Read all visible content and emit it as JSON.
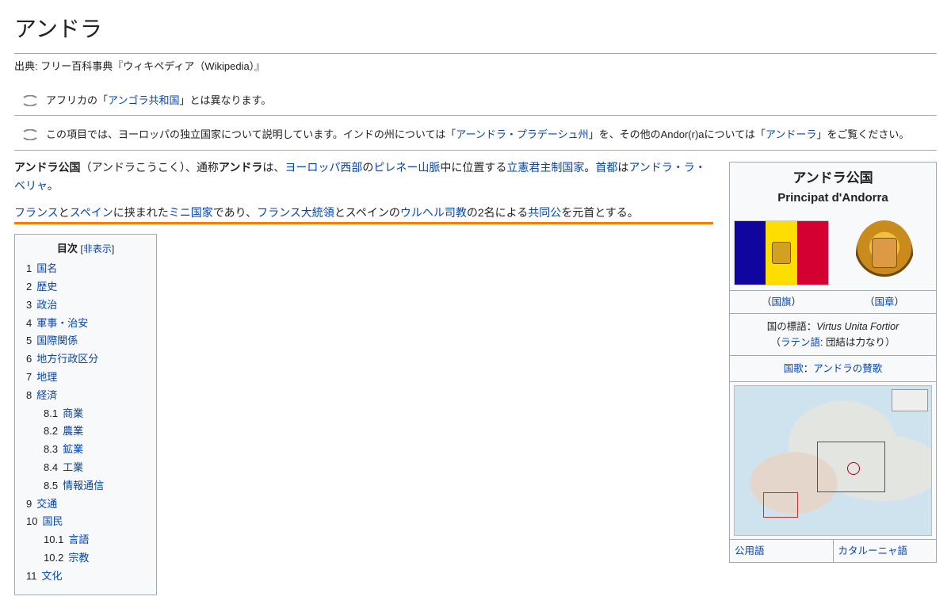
{
  "title": "アンドラ",
  "source_line": "出典: フリー百科事典『ウィキペディア（Wikipedia）』",
  "hatnote1": {
    "pre": "アフリカの「",
    "link": "アンゴラ共和国",
    "post": "」とは異なります。"
  },
  "hatnote2": {
    "t1": "この項目では、ヨーロッパの独立国家について説明しています。インドの州については「",
    "link1": "アーンドラ・プラデーシュ州",
    "t2": "」を、その他のAndor(r)aについては「",
    "link2": "アンドーラ",
    "t3": "」をご覧ください。"
  },
  "lead1": {
    "bold1": "アンドラ公国",
    "t1": "（アンドラこうこく）、通称",
    "bold2": "アンドラ",
    "t2": "は、",
    "link1": "ヨーロッパ西部",
    "t3": "の",
    "link2": "ピレネー山脈",
    "t4": "中に位置する",
    "link3": "立憲君主制国家",
    "t5": "。",
    "link4": "首都",
    "t6": "は",
    "link5": "アンドラ・ラ・ベリャ",
    "t7": "。"
  },
  "lead2": {
    "link1": "フランス",
    "t1": "と",
    "link2": "スペイン",
    "t2": "に挟まれた",
    "link3": "ミニ国家",
    "t3": "であり、",
    "link4": "フランス大統領",
    "t4": "とスペインの",
    "link5": "ウルヘル司教",
    "t5": "の2名による",
    "link6": "共同公",
    "t6": "を元首とする。"
  },
  "toc": {
    "title": "目次",
    "toggle_open": "[",
    "toggle_label": "非表示",
    "toggle_close": "]",
    "items": [
      {
        "num": "1",
        "label": "国名",
        "sub": false
      },
      {
        "num": "2",
        "label": "歴史",
        "sub": false
      },
      {
        "num": "3",
        "label": "政治",
        "sub": false
      },
      {
        "num": "4",
        "label": "軍事・治安",
        "sub": false
      },
      {
        "num": "5",
        "label": "国際関係",
        "sub": false
      },
      {
        "num": "6",
        "label": "地方行政区分",
        "sub": false
      },
      {
        "num": "7",
        "label": "地理",
        "sub": false
      },
      {
        "num": "8",
        "label": "経済",
        "sub": false
      },
      {
        "num": "8.1",
        "label": "商業",
        "sub": true
      },
      {
        "num": "8.2",
        "label": "農業",
        "sub": true
      },
      {
        "num": "8.3",
        "label": "鉱業",
        "sub": true
      },
      {
        "num": "8.4",
        "label": "工業",
        "sub": true
      },
      {
        "num": "8.5",
        "label": "情報通信",
        "sub": true
      },
      {
        "num": "9",
        "label": "交通",
        "sub": false
      },
      {
        "num": "10",
        "label": "国民",
        "sub": false
      },
      {
        "num": "10.1",
        "label": "言語",
        "sub": true
      },
      {
        "num": "10.2",
        "label": "宗教",
        "sub": true
      },
      {
        "num": "11",
        "label": "文化",
        "sub": false
      }
    ]
  },
  "infobox": {
    "title": "アンドラ公国",
    "subtitle": "Principat d'Andorra",
    "flag_caption_open": "（",
    "flag_caption": "国旗",
    "flag_caption_close": "）",
    "coa_caption_open": "（",
    "coa_caption": "国章",
    "coa_caption_close": "）",
    "motto_label": "国の標語：",
    "motto_value": "Virtus Unita Fortior",
    "motto_note_open": "（",
    "motto_note_link": "ラテン語",
    "motto_note_rest": ": 団結は力なり）",
    "anthem_label": "国歌",
    "anthem_sep": "：",
    "anthem_link": "アンドラの賛歌",
    "row_lang_label": "公用語",
    "row_lang_value": "カタルーニャ語"
  }
}
